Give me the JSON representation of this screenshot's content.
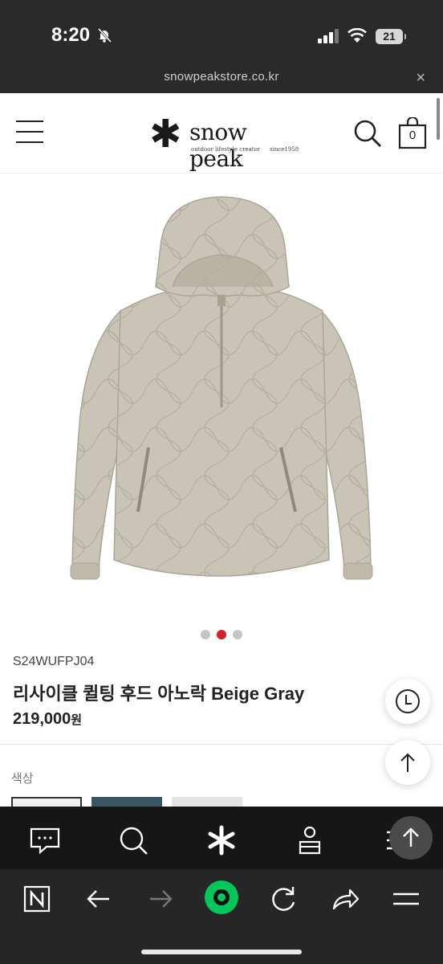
{
  "status_bar": {
    "time": "8:20",
    "battery": "21"
  },
  "browser": {
    "url": "snowpeakstore.co.kr",
    "close_label": "×"
  },
  "header": {
    "logo_star": "✱",
    "logo_text": "snow peak",
    "logo_tagline": "outdoor lifestyle creator",
    "logo_since": "since1958",
    "cart_count": "0"
  },
  "product": {
    "code": "S24WUFPJ04",
    "name": "리사이클 퀼팅 후드 아노락 Beige Gray",
    "price": "219,000",
    "currency": "원",
    "image_count": 3,
    "active_image": 2,
    "jacket_color": "#c9c4b6",
    "color_label": "색상"
  },
  "colors": {
    "accent": "#d42127",
    "nav_bg": "#161616",
    "browser_bg": "#262626",
    "naver_green": "#03c75a"
  }
}
